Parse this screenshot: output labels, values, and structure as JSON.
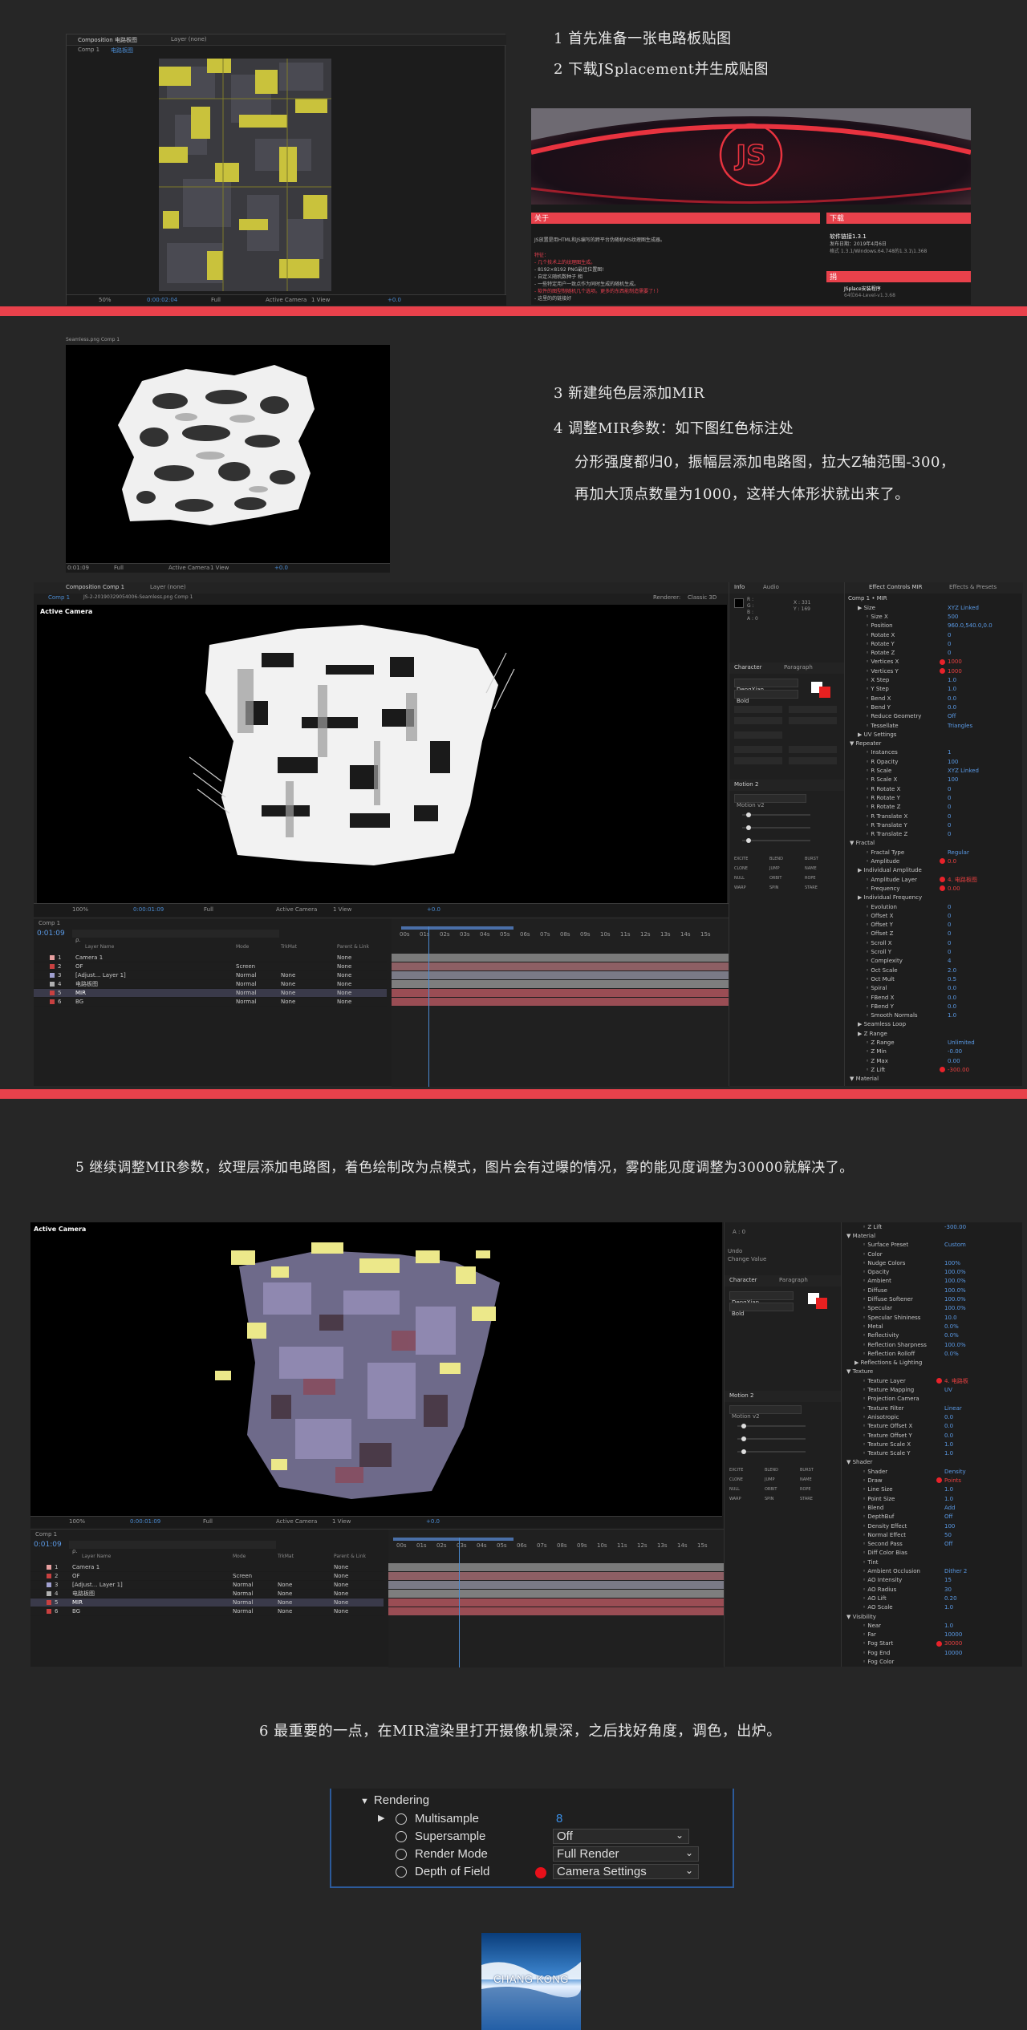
{
  "steps": {
    "s1": "1 首先准备一张电路板贴图",
    "s2": "2 下载JSplacement并生成贴图",
    "s3": "3 新建纯色层添加MIR",
    "s4": "4 调整MIR参数：如下图红色标注处",
    "s4b": "分形强度都归0，振幅层添加电路图，拉大Z轴范围-300，",
    "s4c": "再加大顶点数量为1000，这样大体形状就出来了。",
    "s5": "5 继续调整MIR参数，纹理层添加电路图，着色绘制改为点模式，图片会有过曝的情况，雾的能见度调整为30000就解决了。",
    "s6": "6 最重要的一点，在MIR渲染里打开摄像机景深，之后找好角度，调色，出炉。"
  },
  "shot1": {
    "tab1": "Composition 电路板图",
    "tab2": "Layer (none)",
    "comp": "Comp 1",
    "comp_active": "电路板图",
    "zoom": "50%",
    "time": "0:00:02:04",
    "quality": "Full",
    "camera": "Active Camera",
    "view": "1 View",
    "offset": "+0.0"
  },
  "web": {
    "about_title": "关于",
    "about_line": "JS放置是用HTML和JS编写的跨平台伪随机MS纹理图生成器。",
    "feature_title": "特征：",
    "features": [
      "- 几个技术上的纹理图生成。",
      "- 8192×8192 PNG最佳位置图!",
      "- 自定义随机数种子 相",
      "- 一些特定用户一致点作为同时生成的随机生成。",
      "- 软件的图型制随机几个选项。更多的东西能制造需要了! ）",
      "- 这里的的链接好"
    ],
    "download_title": "下载",
    "download_item": "软件链接1.3.1",
    "download_date": "发布日期：2019年4月6日",
    "download_note": "格式 1.3.1/Windows.64.748的1.3.1\\1.368",
    "donate_title": "捐",
    "donate_item": "JSplace安装程序",
    "donate_sub": "64位64-Level-v1.3.68"
  },
  "shot2": {
    "title": "Seamless.png Comp 1",
    "time": "0:01:09",
    "quality": "Full",
    "camera": "Active Camera",
    "view": "1 View",
    "offset": "+0.0"
  },
  "shot3": {
    "tab1": "Composition Comp 1",
    "tab2": "Layer (none)",
    "comp": "Comp 1",
    "comp_path": "JS-2-20190329054006-Seamless.png Comp 1",
    "renderer": "Renderer:",
    "renderer_value": "Classic 3D",
    "active_camera": "Active Camera",
    "zoom": "100%",
    "time": "0:00:01:09",
    "quality": "Full",
    "camera": "Active Camera",
    "view": "1 View",
    "offset": "+0.0",
    "info_tab": "Info",
    "audio_tab": "Audio",
    "info_rgb": [
      "R :",
      "G :",
      "B :",
      "A : 0"
    ],
    "info_xy": [
      "X : 331",
      "Y : 169"
    ],
    "character_tab": "Character",
    "paragraph_tab": "Paragraph",
    "font": "DengXian",
    "style": "Bold",
    "motion_title": "Motion 2",
    "motion_version": "Motion v2",
    "motion_buttons": [
      "EXCITE",
      "BLEND",
      "BURST",
      "CLONE",
      "JUMP",
      "NAME",
      "NULL",
      "ORBIT",
      "ROPE",
      "WARP",
      "SPIN",
      "STARE"
    ],
    "timeline_time": "0:01:09",
    "timeline_search": "ρ.",
    "tl_headers": [
      "Layer Name",
      "Mode",
      "TrkMat",
      "Parent & Link"
    ],
    "layers": [
      {
        "num": "1",
        "name": "Camera 1",
        "mode": "",
        "trk": "",
        "parent": "None",
        "color": "#e8a0a0"
      },
      {
        "num": "2",
        "name": "OF",
        "mode": "Screen",
        "trk": "",
        "parent": "None",
        "color": "#c84040"
      },
      {
        "num": "3",
        "name": "[Adjust… Layer 1]",
        "mode": "Normal",
        "trk": "None",
        "parent": "None",
        "color": "#a0a0d0"
      },
      {
        "num": "4",
        "name": "电路板图",
        "mode": "Normal",
        "trk": "None",
        "parent": "None",
        "color": "#b0b0b0"
      },
      {
        "num": "5",
        "name": "MIR",
        "mode": "Normal",
        "trk": "None",
        "parent": "None",
        "color": "#c84040"
      },
      {
        "num": "6",
        "name": "BG",
        "mode": "Normal",
        "trk": "None",
        "parent": "None",
        "color": "#c84040"
      }
    ],
    "ruler": [
      "00s",
      "01s",
      "02s",
      "03s",
      "04s",
      "05s",
      "06s",
      "07s",
      "08s",
      "09s",
      "10s",
      "11s",
      "12s",
      "13s",
      "14s",
      "15s"
    ],
    "effect_tab": "Effect Controls MIR",
    "presets_tab": "Effects & Presets",
    "effect_comp": "Comp 1 • MIR",
    "effects": [
      {
        "label": "Size",
        "value": "XYZ Linked",
        "indent": 1,
        "red": false
      },
      {
        "label": "Size X",
        "value": "500",
        "indent": 2,
        "red": false
      },
      {
        "label": "Position",
        "value": "960.0,540.0,0.0",
        "indent": 2,
        "red": false
      },
      {
        "label": "Rotate X",
        "value": "0",
        "indent": 2,
        "red": false
      },
      {
        "label": "Rotate Y",
        "value": "0",
        "indent": 2,
        "red": false
      },
      {
        "label": "Rotate Z",
        "value": "0",
        "indent": 2,
        "red": false
      },
      {
        "label": "Vertices X",
        "value": "1000",
        "indent": 2,
        "red": true
      },
      {
        "label": "Vertices Y",
        "value": "1000",
        "indent": 2,
        "red": true
      },
      {
        "label": "X Step",
        "value": "1.0",
        "indent": 2,
        "red": false
      },
      {
        "label": "Y Step",
        "value": "1.0",
        "indent": 2,
        "red": false
      },
      {
        "label": "Bend X",
        "value": "0.0",
        "indent": 2,
        "red": false
      },
      {
        "label": "Bend Y",
        "value": "0.0",
        "indent": 2,
        "red": false
      },
      {
        "label": "Reduce Geometry",
        "value": "Off",
        "indent": 2,
        "red": false
      },
      {
        "label": "Tessellate",
        "value": "Triangles",
        "indent": 2,
        "red": false
      },
      {
        "label": "UV Settings",
        "value": "",
        "indent": 1,
        "red": false
      },
      {
        "label": "Repeater",
        "value": "",
        "indent": 0,
        "red": false
      },
      {
        "label": "Instances",
        "value": "1",
        "indent": 2,
        "red": false
      },
      {
        "label": "R Opacity",
        "value": "100",
        "indent": 2,
        "red": false
      },
      {
        "label": "R Scale",
        "value": "XYZ Linked",
        "indent": 2,
        "red": false
      },
      {
        "label": "R Scale X",
        "value": "100",
        "indent": 2,
        "red": false
      },
      {
        "label": "R Rotate X",
        "value": "0",
        "indent": 2,
        "red": false
      },
      {
        "label": "R Rotate Y",
        "value": "0",
        "indent": 2,
        "red": false
      },
      {
        "label": "R Rotate Z",
        "value": "0",
        "indent": 2,
        "red": false
      },
      {
        "label": "R Translate X",
        "value": "0",
        "indent": 2,
        "red": false
      },
      {
        "label": "R Translate Y",
        "value": "0",
        "indent": 2,
        "red": false
      },
      {
        "label": "R Translate Z",
        "value": "0",
        "indent": 2,
        "red": false
      },
      {
        "label": "Fractal",
        "value": "",
        "indent": 0,
        "red": false
      },
      {
        "label": "Fractal Type",
        "value": "Regular",
        "indent": 2,
        "red": false
      },
      {
        "label": "Amplitude",
        "value": "0.0",
        "indent": 2,
        "red": true
      },
      {
        "label": "Individual Amplitude",
        "value": "",
        "indent": 1,
        "red": false
      },
      {
        "label": "Amplitude Layer",
        "value": "4. 电路板图",
        "indent": 2,
        "red": true
      },
      {
        "label": "Frequency",
        "value": "0.00",
        "indent": 2,
        "red": true
      },
      {
        "label": "Individual Frequency",
        "value": "",
        "indent": 1,
        "red": false
      },
      {
        "label": "Evolution",
        "value": "0",
        "indent": 2,
        "red": false
      },
      {
        "label": "Offset X",
        "value": "0",
        "indent": 2,
        "red": false
      },
      {
        "label": "Offset Y",
        "value": "0",
        "indent": 2,
        "red": false
      },
      {
        "label": "Offset Z",
        "value": "0",
        "indent": 2,
        "red": false
      },
      {
        "label": "Scroll X",
        "value": "0",
        "indent": 2,
        "red": false
      },
      {
        "label": "Scroll Y",
        "value": "0",
        "indent": 2,
        "red": false
      },
      {
        "label": "Complexity",
        "value": "4",
        "indent": 2,
        "red": false
      },
      {
        "label": "Oct Scale",
        "value": "2.0",
        "indent": 2,
        "red": false
      },
      {
        "label": "Oct Mult",
        "value": "0.5",
        "indent": 2,
        "red": false
      },
      {
        "label": "Spiral",
        "value": "0.0",
        "indent": 2,
        "red": false
      },
      {
        "label": "FBend X",
        "value": "0.0",
        "indent": 2,
        "red": false
      },
      {
        "label": "FBend Y",
        "value": "0.0",
        "indent": 2,
        "red": false
      },
      {
        "label": "Smooth Normals",
        "value": "1.0",
        "indent": 2,
        "red": false
      },
      {
        "label": "Seamless Loop",
        "value": "",
        "indent": 1,
        "red": false
      },
      {
        "label": "Z Range",
        "value": "",
        "indent": 1,
        "red": false
      },
      {
        "label": "Z Range",
        "value": "Unlimited",
        "indent": 2,
        "red": false
      },
      {
        "label": "Z Min",
        "value": "-0.00",
        "indent": 2,
        "red": false
      },
      {
        "label": "Z Max",
        "value": "0.00",
        "indent": 2,
        "red": false
      },
      {
        "label": "Z Lift",
        "value": "-300.00",
        "indent": 2,
        "red": true
      },
      {
        "label": "Material",
        "value": "",
        "indent": 0,
        "red": false
      }
    ]
  },
  "shot4": {
    "active_camera": "Active Camera",
    "undo": "Undo",
    "undo_sub": "Change Value",
    "info_a": "A : 0",
    "zoom": "100%",
    "time": "0:00:01:09",
    "quality": "Full",
    "camera": "Active Camera",
    "view": "1 View",
    "offset": "+0.0",
    "timeline_time": "0:01:09",
    "effects": [
      {
        "label": "Z Lift",
        "value": "-300.00",
        "indent": 2,
        "red": false
      },
      {
        "label": "Material",
        "value": "",
        "indent": 0,
        "red": false
      },
      {
        "label": "Surface Preset",
        "value": "Custom",
        "indent": 2,
        "red": false
      },
      {
        "label": "Color",
        "value": "",
        "indent": 2,
        "red": false
      },
      {
        "label": "Nudge Colors",
        "value": "100%",
        "indent": 2,
        "red": false
      },
      {
        "label": "Opacity",
        "value": "100.0%",
        "indent": 2,
        "red": false
      },
      {
        "label": "Ambient",
        "value": "100.0%",
        "indent": 2,
        "red": false
      },
      {
        "label": "Diffuse",
        "value": "100.0%",
        "indent": 2,
        "red": false
      },
      {
        "label": "Diffuse Softener",
        "value": "100.0%",
        "indent": 2,
        "red": false
      },
      {
        "label": "Specular",
        "value": "100.0%",
        "indent": 2,
        "red": false
      },
      {
        "label": "Specular Shininess",
        "value": "10.0",
        "indent": 2,
        "red": false
      },
      {
        "label": "Metal",
        "value": "0.0%",
        "indent": 2,
        "red": false
      },
      {
        "label": "Reflectivity",
        "value": "0.0%",
        "indent": 2,
        "red": false
      },
      {
        "label": "Reflection Sharpness",
        "value": "100.0%",
        "indent": 2,
        "red": false
      },
      {
        "label": "Reflection Rolloff",
        "value": "0.0%",
        "indent": 2,
        "red": false
      },
      {
        "label": "Reflections & Lighting",
        "value": "",
        "indent": 1,
        "red": false
      },
      {
        "label": "Texture",
        "value": "",
        "indent": 0,
        "red": false
      },
      {
        "label": "Texture Layer",
        "value": "4. 电路板",
        "indent": 2,
        "red": true
      },
      {
        "label": "Texture Mapping",
        "value": "UV",
        "indent": 2,
        "red": false
      },
      {
        "label": "Projection Camera",
        "value": "",
        "indent": 2,
        "red": false
      },
      {
        "label": "Texture Filter",
        "value": "Linear",
        "indent": 2,
        "red": false
      },
      {
        "label": "Anisotropic",
        "value": "0.0",
        "indent": 2,
        "red": false
      },
      {
        "label": "Texture Offset X",
        "value": "0.0",
        "indent": 2,
        "red": false
      },
      {
        "label": "Texture Offset Y",
        "value": "0.0",
        "indent": 2,
        "red": false
      },
      {
        "label": "Texture Scale X",
        "value": "1.0",
        "indent": 2,
        "red": false
      },
      {
        "label": "Texture Scale Y",
        "value": "1.0",
        "indent": 2,
        "red": false
      },
      {
        "label": "Shader",
        "value": "",
        "indent": 0,
        "red": false
      },
      {
        "label": "Shader",
        "value": "Density",
        "indent": 2,
        "red": false
      },
      {
        "label": "Draw",
        "value": "Points",
        "indent": 2,
        "red": true
      },
      {
        "label": "Line Size",
        "value": "1.0",
        "indent": 2,
        "red": false
      },
      {
        "label": "Point Size",
        "value": "1.0",
        "indent": 2,
        "red": false
      },
      {
        "label": "Blend",
        "value": "Add",
        "indent": 2,
        "red": false
      },
      {
        "label": "DepthBuf",
        "value": "Off",
        "indent": 2,
        "red": false
      },
      {
        "label": "Density Effect",
        "value": "100",
        "indent": 2,
        "red": false
      },
      {
        "label": "Normal Effect",
        "value": "50",
        "indent": 2,
        "red": false
      },
      {
        "label": "Second Pass",
        "value": "Off",
        "indent": 2,
        "red": false
      },
      {
        "label": "Diff Color Bias",
        "value": "",
        "indent": 2,
        "red": false
      },
      {
        "label": "Tint",
        "value": "",
        "indent": 2,
        "red": false
      },
      {
        "label": "Ambient Occlusion",
        "value": "Dither 2",
        "indent": 2,
        "red": false
      },
      {
        "label": "AO Intensity",
        "value": "15",
        "indent": 2,
        "red": false
      },
      {
        "label": "AO Radius",
        "value": "30",
        "indent": 2,
        "red": false
      },
      {
        "label": "AO Lift",
        "value": "0.20",
        "indent": 2,
        "red": false
      },
      {
        "label": "AO Scale",
        "value": "1.0",
        "indent": 2,
        "red": false
      },
      {
        "label": "Visibility",
        "value": "",
        "indent": 0,
        "red": false
      },
      {
        "label": "Near",
        "value": "1.0",
        "indent": 2,
        "red": false
      },
      {
        "label": "Far",
        "value": "10000",
        "indent": 2,
        "red": false
      },
      {
        "label": "Fog Start",
        "value": "30000",
        "indent": 2,
        "red": true
      },
      {
        "label": "Fog End",
        "value": "10000",
        "indent": 2,
        "red": false
      },
      {
        "label": "Fog Color",
        "value": "",
        "indent": 2,
        "red": false
      }
    ]
  },
  "rendering": {
    "head": "Rendering",
    "rows": [
      {
        "label": "Multisample",
        "value": "8",
        "kind": "num",
        "red": false
      },
      {
        "label": "Supersample",
        "value": "Off",
        "kind": "select",
        "red": false
      },
      {
        "label": "Render Mode",
        "value": "Full Render",
        "kind": "select",
        "red": false
      },
      {
        "label": "Depth of Field",
        "value": "Camera Settings",
        "kind": "select",
        "red": true
      }
    ]
  },
  "logo": {
    "text": "CHANG KONG"
  },
  "colors": {
    "accent_red": "#e8414b",
    "ae_blue": "#4a8ad0",
    "bg": "#262626"
  }
}
